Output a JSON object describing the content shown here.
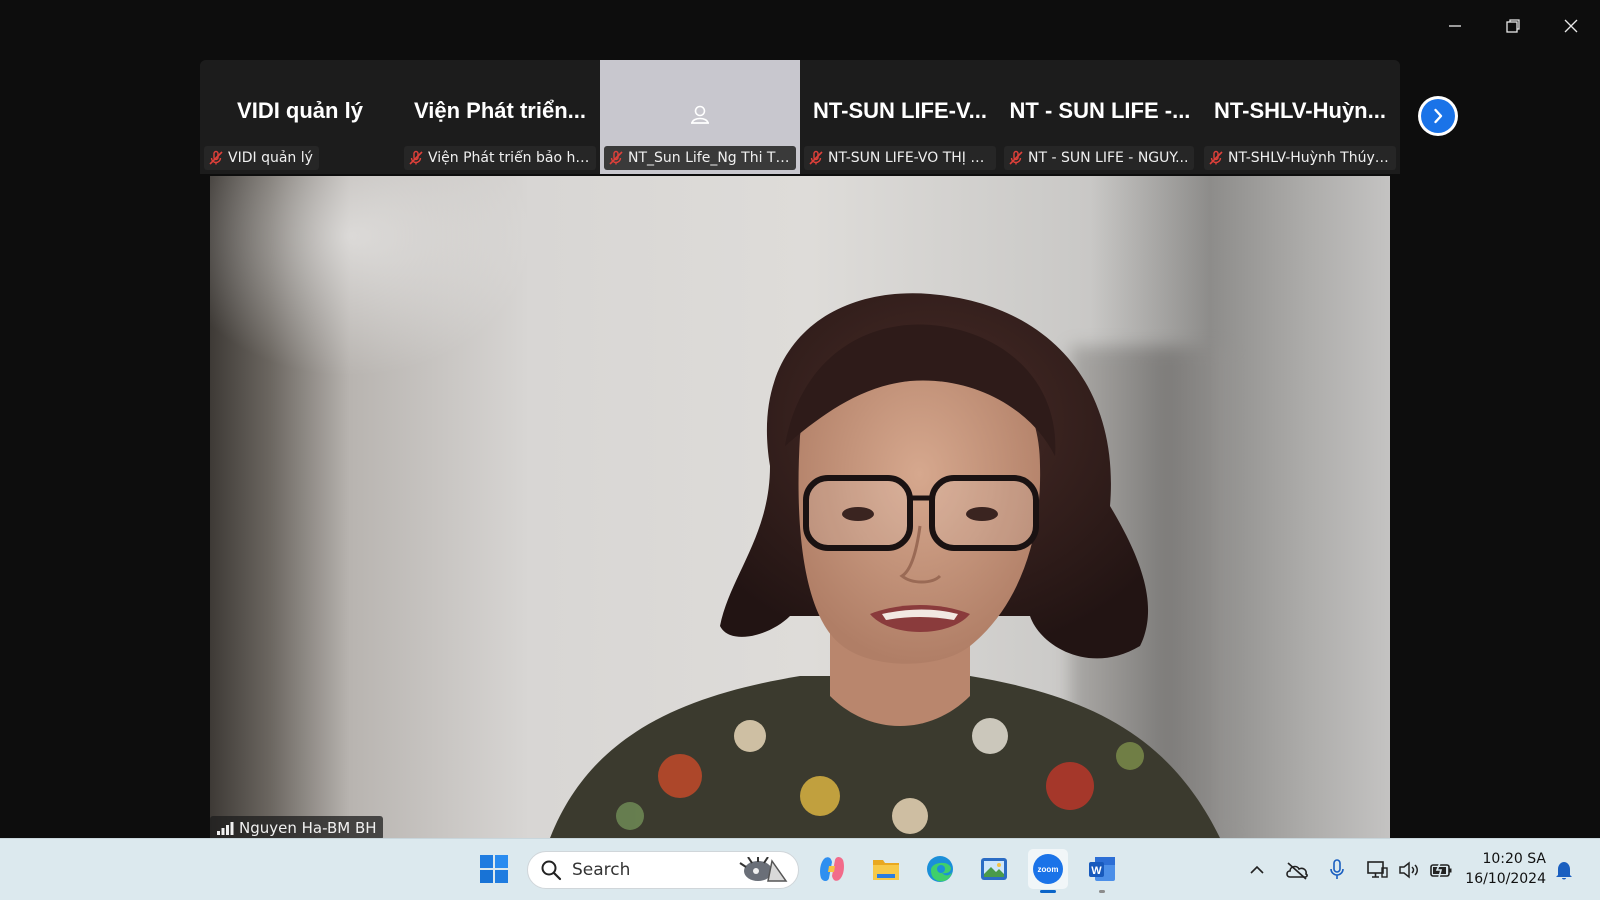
{
  "window": {
    "controls": [
      "minimize-icon",
      "restore-icon",
      "close-icon"
    ]
  },
  "participants": [
    {
      "title": "VIDI quản lý",
      "label": "VIDI quản lý",
      "muted": true,
      "active": false
    },
    {
      "title": "Viện Phát triển...",
      "label": "Viện Phát triển bảo hi...",
      "muted": true,
      "active": false
    },
    {
      "title": "",
      "label": "NT_Sun Life_Ng Thi Th...",
      "muted": true,
      "active": true
    },
    {
      "title": "NT-SUN LIFE-V...",
      "label": "NT-SUN LIFE-VÕ THỊ C...",
      "muted": true,
      "active": false
    },
    {
      "title": "NT - SUN LIFE -...",
      "label": "NT - SUN LIFE - NGUY...",
      "muted": true,
      "active": false
    },
    {
      "title": "NT-SHLV-Huỳn...",
      "label": "NT-SHLV-Huỳnh Thúy ...",
      "muted": true,
      "active": false
    }
  ],
  "speaker": {
    "name": "Nguyen Ha-BM BH"
  },
  "taskbar": {
    "search_placeholder": "Search",
    "apps": [
      "windows-start-icon",
      "copilot-icon",
      "file-explorer-icon",
      "edge-icon",
      "photos-app-icon",
      "zoom-icon",
      "word-icon"
    ],
    "tray": [
      "chevron-up-icon",
      "onedrive-icon",
      "microphone-icon",
      "network-icon",
      "volume-icon",
      "battery-icon"
    ],
    "time": "10:20 SA",
    "date": "16/10/2024"
  },
  "colors": {
    "zoom_blue": "#1a73e8",
    "mute_red": "#e0403a",
    "taskbar_bg": "#dce9ee"
  }
}
